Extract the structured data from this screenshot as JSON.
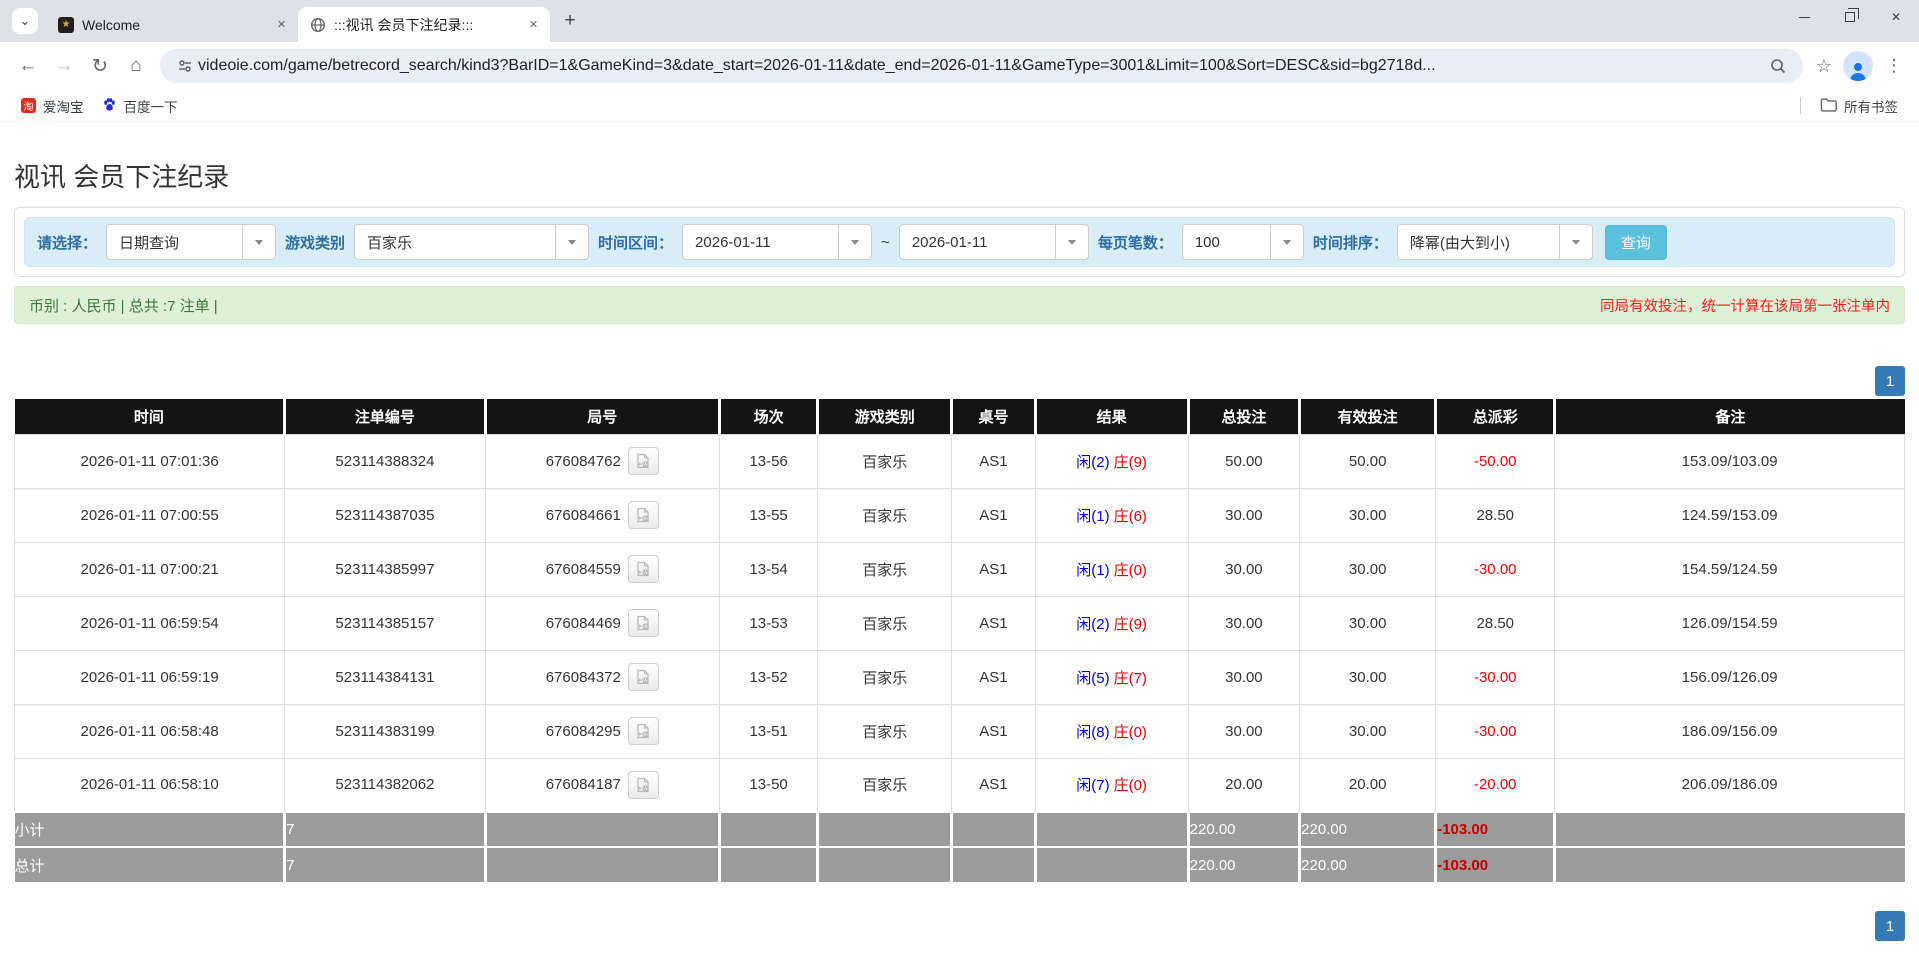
{
  "browser": {
    "tabs": [
      {
        "title": "Welcome"
      },
      {
        "title": ":::视讯 会员下注纪录:::"
      }
    ],
    "url": "videoie.com/game/betrecord_search/kind3?BarID=1&GameKind=3&date_start=2026-01-11&date_end=2026-01-11&GameType=3001&Limit=100&Sort=DESC&sid=bg2718d...",
    "bookmarks": [
      {
        "label": "爱淘宝",
        "icon_glyph": "淘"
      },
      {
        "label": "百度一下"
      }
    ],
    "all_bookmarks_label": "所有书签",
    "icons": {
      "tab_chevron": "⌄",
      "tab_close": "✕",
      "new_tab": "+",
      "close_window": "✕",
      "back": "←",
      "forward": "→",
      "reload": "↻",
      "home": "⌂",
      "star": "☆",
      "menu": "⋮",
      "welcome_favicon_glyph": "★"
    }
  },
  "page": {
    "title": "视讯 会员下注纪录",
    "filters": {
      "select_label": "请选择：",
      "select_value": "日期查询",
      "game_kind_label": "游戏类别",
      "game_kind_value": "百家乐",
      "date_range_label": "时间区间：",
      "date_start": "2026-01-11",
      "date_separator": "~",
      "date_end": "2026-01-11",
      "per_page_label": "每页笔数：",
      "per_page_value": "100",
      "sort_label": "时间排序：",
      "sort_value": "降幂(由大到小)",
      "search_button": "查询"
    },
    "notice": {
      "left": "币别 : 人民币 | 总共 :7 注单 |",
      "right": "同局有效投注，统一计算在该局第一张注单内"
    },
    "pagination": {
      "page": "1"
    },
    "table": {
      "headers": [
        "时间",
        "注单编号",
        "局号",
        "场次",
        "游戏类别",
        "桌号",
        "结果",
        "总投注",
        "有效投注",
        "总派彩",
        "备注"
      ],
      "rows": [
        {
          "time": "2026-01-11 07:01:36",
          "bet_id": "523114388324",
          "round": "676084762",
          "session": "13-56",
          "game": "百家乐",
          "table": "AS1",
          "result_player": "闲(2)",
          "result_banker": "庄(9)",
          "total_bet": "50.00",
          "valid_bet": "50.00",
          "payout": "-50.00",
          "note": "153.09/103.09"
        },
        {
          "time": "2026-01-11 07:00:55",
          "bet_id": "523114387035",
          "round": "676084661",
          "session": "13-55",
          "game": "百家乐",
          "table": "AS1",
          "result_player": "闲(1)",
          "result_banker": "庄(6)",
          "total_bet": "30.00",
          "valid_bet": "30.00",
          "payout": "28.50",
          "note": "124.59/153.09"
        },
        {
          "time": "2026-01-11 07:00:21",
          "bet_id": "523114385997",
          "round": "676084559",
          "session": "13-54",
          "game": "百家乐",
          "table": "AS1",
          "result_player": "闲(1)",
          "result_banker": "庄(0)",
          "total_bet": "30.00",
          "valid_bet": "30.00",
          "payout": "-30.00",
          "note": "154.59/124.59"
        },
        {
          "time": "2026-01-11 06:59:54",
          "bet_id": "523114385157",
          "round": "676084469",
          "session": "13-53",
          "game": "百家乐",
          "table": "AS1",
          "result_player": "闲(2)",
          "result_banker": "庄(9)",
          "total_bet": "30.00",
          "valid_bet": "30.00",
          "payout": "28.50",
          "note": "126.09/154.59"
        },
        {
          "time": "2026-01-11 06:59:19",
          "bet_id": "523114384131",
          "round": "676084372",
          "session": "13-52",
          "game": "百家乐",
          "table": "AS1",
          "result_player": "闲(5)",
          "result_banker": "庄(7)",
          "total_bet": "30.00",
          "valid_bet": "30.00",
          "payout": "-30.00",
          "note": "156.09/126.09"
        },
        {
          "time": "2026-01-11 06:58:48",
          "bet_id": "523114383199",
          "round": "676084295",
          "session": "13-51",
          "game": "百家乐",
          "table": "AS1",
          "result_player": "闲(8)",
          "result_banker": "庄(0)",
          "total_bet": "30.00",
          "valid_bet": "30.00",
          "payout": "-30.00",
          "note": "186.09/156.09"
        },
        {
          "time": "2026-01-11 06:58:10",
          "bet_id": "523114382062",
          "round": "676084187",
          "session": "13-50",
          "game": "百家乐",
          "table": "AS1",
          "result_player": "闲(7)",
          "result_banker": "庄(0)",
          "total_bet": "20.00",
          "valid_bet": "20.00",
          "payout": "-20.00",
          "note": "206.09/186.09"
        }
      ],
      "subtotal": {
        "label": "小计",
        "count": "7",
        "total_bet": "220.00",
        "valid_bet": "220.00",
        "payout": "-103.00"
      },
      "total": {
        "label": "总计",
        "count": "7",
        "total_bet": "220.00",
        "valid_bet": "220.00",
        "payout": "-103.00"
      }
    }
  },
  "colors": {
    "table_header_bg": "#141414",
    "filter_bar_bg": "#d9edf7",
    "filter_label_blue": "#2e6da4",
    "search_button_bg": "#5bc0de",
    "notice_bg": "#dff0d8",
    "notice_text": "#3c763d",
    "notice_warning_red": "#ff1a1a",
    "pagination_blue": "#337ab7",
    "total_bet_blue": "#1a73e8",
    "result_player_blue": "#0000e0",
    "result_banker_red": "#e00000",
    "payout_negative_red": "#ee0000",
    "summary_row_bg": "#9c9c9c",
    "summary_payout_red": "#c80000"
  }
}
